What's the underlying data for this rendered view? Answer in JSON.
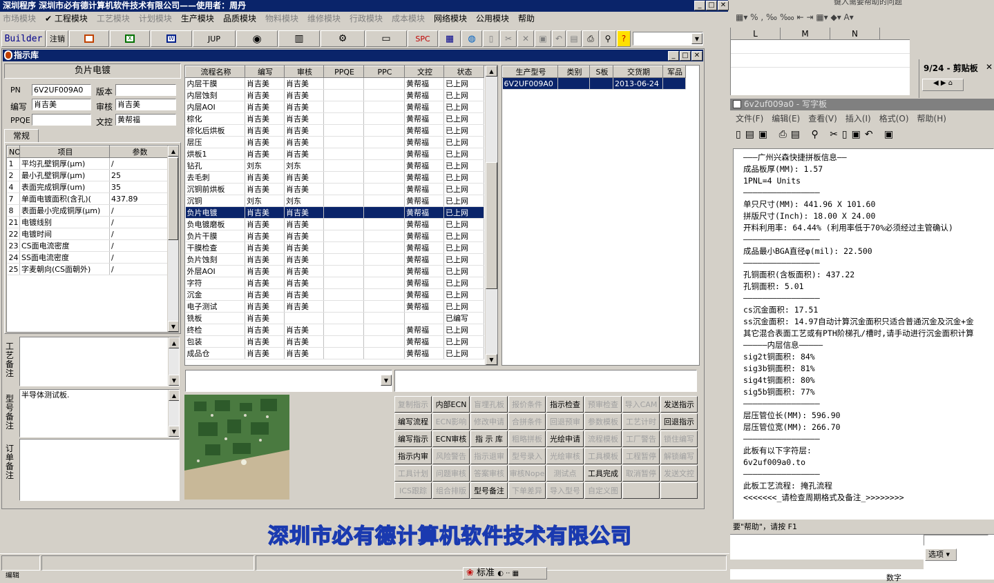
{
  "main_window": {
    "title": "深圳程序    深圳市必有德计算机软件技术有限公司——使用者：周丹"
  },
  "main_menu": [
    {
      "label": "市场模块",
      "enabled": false
    },
    {
      "label": "✔ 工程模块",
      "enabled": true
    },
    {
      "label": "工艺模块",
      "enabled": false
    },
    {
      "label": "计划模块",
      "enabled": false
    },
    {
      "label": "生产模块",
      "enabled": true
    },
    {
      "label": "品质模块",
      "enabled": true
    },
    {
      "label": "物料模块",
      "enabled": false
    },
    {
      "label": "维修模块",
      "enabled": false
    },
    {
      "label": "行政模块",
      "enabled": false
    },
    {
      "label": "成本模块",
      "enabled": false
    },
    {
      "label": "网络模块",
      "enabled": true
    },
    {
      "label": "公用模块",
      "enabled": true
    },
    {
      "label": "帮助",
      "enabled": true
    }
  ],
  "toolbar": {
    "builder": "Builder",
    "logout": "注销",
    "jup": "JUP",
    "spc": "SPC"
  },
  "instruction_window": {
    "title": "指示库",
    "process_name": "负片电镀",
    "pn_label": "PN",
    "pn": "6V2UF009A0",
    "version_label": "版本",
    "version": "",
    "writer_label": "编写",
    "writer": "肖吉美",
    "reviewer_label": "审核",
    "reviewer": "肖吉美",
    "ppqe_label": "PPQE",
    "ppqe": "",
    "doc_label": "文控",
    "doc": "黄帮福",
    "tab": "常规",
    "param_headers": [
      "NO",
      "项目",
      "参数"
    ],
    "params": [
      [
        "1",
        "平均孔壁铜厚(μm)",
        "/"
      ],
      [
        "2",
        "最小孔壁铜厚(μm)",
        "25"
      ],
      [
        "4",
        "表面完成铜厚(um)",
        "35"
      ],
      [
        "7",
        "单面电镀面积(含孔)(",
        "437.89"
      ],
      [
        "8",
        "表面最小完成铜厚(μm)",
        "/"
      ],
      [
        "21",
        "电镀线别",
        "/"
      ],
      [
        "22",
        "电镀时间",
        "/"
      ],
      [
        "23",
        "CS面电流密度",
        "/"
      ],
      [
        "24",
        "SS面电流密度",
        "/"
      ],
      [
        "25",
        "字麦朝向(CS面朝外)",
        "/"
      ]
    ],
    "notes": [
      {
        "label": "工艺备注",
        "value": ""
      },
      {
        "label": "型号备注",
        "value": "半导体测试板."
      },
      {
        "label": "订单备注",
        "value": ""
      }
    ],
    "flow_headers": [
      "流程名称",
      "编写",
      "审核",
      "PPQE",
      "PPC",
      "文控",
      "状态"
    ],
    "flows": [
      [
        "内层干膜",
        "肖吉美",
        "肖吉美",
        "",
        "",
        "黄帮福",
        "已上网"
      ],
      [
        "内层蚀刻",
        "肖吉美",
        "肖吉美",
        "",
        "",
        "黄帮福",
        "已上网"
      ],
      [
        "内层AOI",
        "肖吉美",
        "肖吉美",
        "",
        "",
        "黄帮福",
        "已上网"
      ],
      [
        "棕化",
        "肖吉美",
        "肖吉美",
        "",
        "",
        "黄帮福",
        "已上网"
      ],
      [
        "棕化后烘板",
        "肖吉美",
        "肖吉美",
        "",
        "",
        "黄帮福",
        "已上网"
      ],
      [
        "层压",
        "肖吉美",
        "肖吉美",
        "",
        "",
        "黄帮福",
        "已上网"
      ],
      [
        "烘板1",
        "肖吉美",
        "肖吉美",
        "",
        "",
        "黄帮福",
        "已上网"
      ],
      [
        "钻孔",
        "刘东",
        "刘东",
        "",
        "",
        "黄帮福",
        "已上网"
      ],
      [
        "去毛刺",
        "肖吉美",
        "肖吉美",
        "",
        "",
        "黄帮福",
        "已上网"
      ],
      [
        "沉铜前烘板",
        "肖吉美",
        "肖吉美",
        "",
        "",
        "黄帮福",
        "已上网"
      ],
      [
        "沉铜",
        "刘东",
        "刘东",
        "",
        "",
        "黄帮福",
        "已上网"
      ],
      [
        "负片电镀",
        "肖吉美",
        "肖吉美",
        "",
        "",
        "黄帮福",
        "已上网"
      ],
      [
        "负电镀磨板",
        "肖吉美",
        "肖吉美",
        "",
        "",
        "黄帮福",
        "已上网"
      ],
      [
        "负片干膜",
        "肖吉美",
        "肖吉美",
        "",
        "",
        "黄帮福",
        "已上网"
      ],
      [
        "干膜检查",
        "肖吉美",
        "肖吉美",
        "",
        "",
        "黄帮福",
        "已上网"
      ],
      [
        "负片蚀刻",
        "肖吉美",
        "肖吉美",
        "",
        "",
        "黄帮福",
        "已上网"
      ],
      [
        "外层AOI",
        "肖吉美",
        "肖吉美",
        "",
        "",
        "黄帮福",
        "已上网"
      ],
      [
        "字符",
        "肖吉美",
        "肖吉美",
        "",
        "",
        "黄帮福",
        "已上网"
      ],
      [
        "沉金",
        "肖吉美",
        "肖吉美",
        "",
        "",
        "黄帮福",
        "已上网"
      ],
      [
        "电子测试",
        "肖吉美",
        "肖吉美",
        "",
        "",
        "黄帮福",
        "已上网"
      ],
      [
        "铣板",
        "肖吉美",
        "",
        "",
        "",
        "",
        "已编写"
      ],
      [
        "终检",
        "肖吉美",
        "肖吉美",
        "",
        "",
        "黄帮福",
        "已上网"
      ],
      [
        "包装",
        "肖吉美",
        "肖吉美",
        "",
        "",
        "黄帮福",
        "已上网"
      ],
      [
        "成品仓",
        "肖吉美",
        "肖吉美",
        "",
        "",
        "黄帮福",
        "已上网"
      ]
    ],
    "selected_flow": 11,
    "model_headers": [
      "生产型号",
      "类别",
      "S板",
      "交货期",
      "军品"
    ],
    "models": [
      [
        "6V2UF009A0",
        "",
        "",
        "2013-06-24",
        ""
      ]
    ],
    "action_buttons": [
      [
        {
          "l": "复制指示",
          "e": false
        },
        {
          "l": "内部ECN",
          "e": true
        },
        {
          "l": "盲埋孔板",
          "e": false
        },
        {
          "l": "报价条件",
          "e": false
        },
        {
          "l": "指示检查",
          "e": true
        },
        {
          "l": "预审检查",
          "e": false
        },
        {
          "l": "导入CAM",
          "e": false
        },
        {
          "l": "发送指示",
          "e": true
        }
      ],
      [
        {
          "l": "编写流程",
          "e": true
        },
        {
          "l": "ECN影响",
          "e": false
        },
        {
          "l": "修改申请",
          "e": false
        },
        {
          "l": "合拼条件",
          "e": false
        },
        {
          "l": "回退预审",
          "e": false
        },
        {
          "l": "参数模板",
          "e": false
        },
        {
          "l": "工艺计时",
          "e": false
        },
        {
          "l": "回退指示",
          "e": true
        }
      ],
      [
        {
          "l": "编写指示",
          "e": true
        },
        {
          "l": "ECN审核",
          "e": true
        },
        {
          "l": "指 示 库",
          "e": true
        },
        {
          "l": "粗略拼板",
          "e": false
        },
        {
          "l": "光绘申请",
          "e": true
        },
        {
          "l": "流程模板",
          "e": false
        },
        {
          "l": "工厂警告",
          "e": false
        },
        {
          "l": "锁住编写",
          "e": false
        }
      ],
      [
        {
          "l": "指示内审",
          "e": true
        },
        {
          "l": "风险警告",
          "e": false
        },
        {
          "l": "指示退审",
          "e": false
        },
        {
          "l": "型号录入",
          "e": false
        },
        {
          "l": "光绘审核",
          "e": false
        },
        {
          "l": "工具模板",
          "e": false
        },
        {
          "l": "工程暂停",
          "e": false
        },
        {
          "l": "解锁编写",
          "e": false
        }
      ],
      [
        {
          "l": "工具计划",
          "e": false
        },
        {
          "l": "问题审核",
          "e": false
        },
        {
          "l": "答案审核",
          "e": false
        },
        {
          "l": "审核Nope",
          "e": false
        },
        {
          "l": "测试点",
          "e": false
        },
        {
          "l": "工具完成",
          "e": true
        },
        {
          "l": "取消暂停",
          "e": false
        },
        {
          "l": "发送文控",
          "e": false
        }
      ],
      [
        {
          "l": "ICS跟踪",
          "e": false
        },
        {
          "l": "组合排版",
          "e": false
        },
        {
          "l": "型号备注",
          "e": true
        },
        {
          "l": "下单差异",
          "e": false
        },
        {
          "l": "导入型号",
          "e": false
        },
        {
          "l": "自定义图",
          "e": false
        },
        {
          "l": "",
          "e": false
        },
        {
          "l": "",
          "e": false
        }
      ]
    ]
  },
  "company_banner": "深圳市必有德计算机软件技术有限公司",
  "bottom_status": {
    "left": "编辑",
    "ime": "标准"
  },
  "excel": {
    "hint": "键入需要帮助的问题",
    "columns": [
      "L",
      "M",
      "N"
    ],
    "clip_title": "9/24 - 剪贴板",
    "options": "选项",
    "status": "数字"
  },
  "wordpad": {
    "title": "6v2uf009a0 - 写字板",
    "menu": [
      "文件(F)",
      "编辑(E)",
      "查看(V)",
      "插入(I)",
      "格式(O)",
      "帮助(H)"
    ],
    "status": "要\"帮助\"，请按 F1",
    "lines": [
      "———广州兴森快捷拼板信息——",
      "成品板厚(MM): 1.57",
      "1PNL=4 Units",
      "————————————————",
      "单只尺寸(MM): 441.96 X 101.60",
      "拼版尺寸(Inch): 18.00 X 24.00",
      "开料利用率: 64.44% (利用率低于70%必须经过主管确认)",
      "————————————————",
      "成品最小BGA直径φ(mil): 22.500",
      "————————————————",
      "孔铜面积(含板面积): 437.22",
      "孔铜面积: 5.01",
      "————————————————",
      "cs沉金面积: 17.51",
      "ss沉金面积: 14.97自动计算沉金面积只适合普通沉金及沉金+金",
      "其它混合表面工艺或有PTH阶梯孔/槽时,请手动进行沉金面积计算",
      "—————内层信息—————",
      "sig2t铜面积: 84%",
      "sig3b铜面积: 81%",
      "sig4t铜面积: 80%",
      "sig5b铜面积: 77%",
      "————————————————",
      "层压管位长(MM): 596.90",
      "层压管位宽(MM): 266.70",
      "————————————————",
      "此板有以下字符层:",
      "6v2uf009a0.to",
      "————————————————",
      "此板工艺流程: 掩孔流程",
      "<<<<<<<_请检查周期格式及备注_>>>>>>>>"
    ]
  }
}
